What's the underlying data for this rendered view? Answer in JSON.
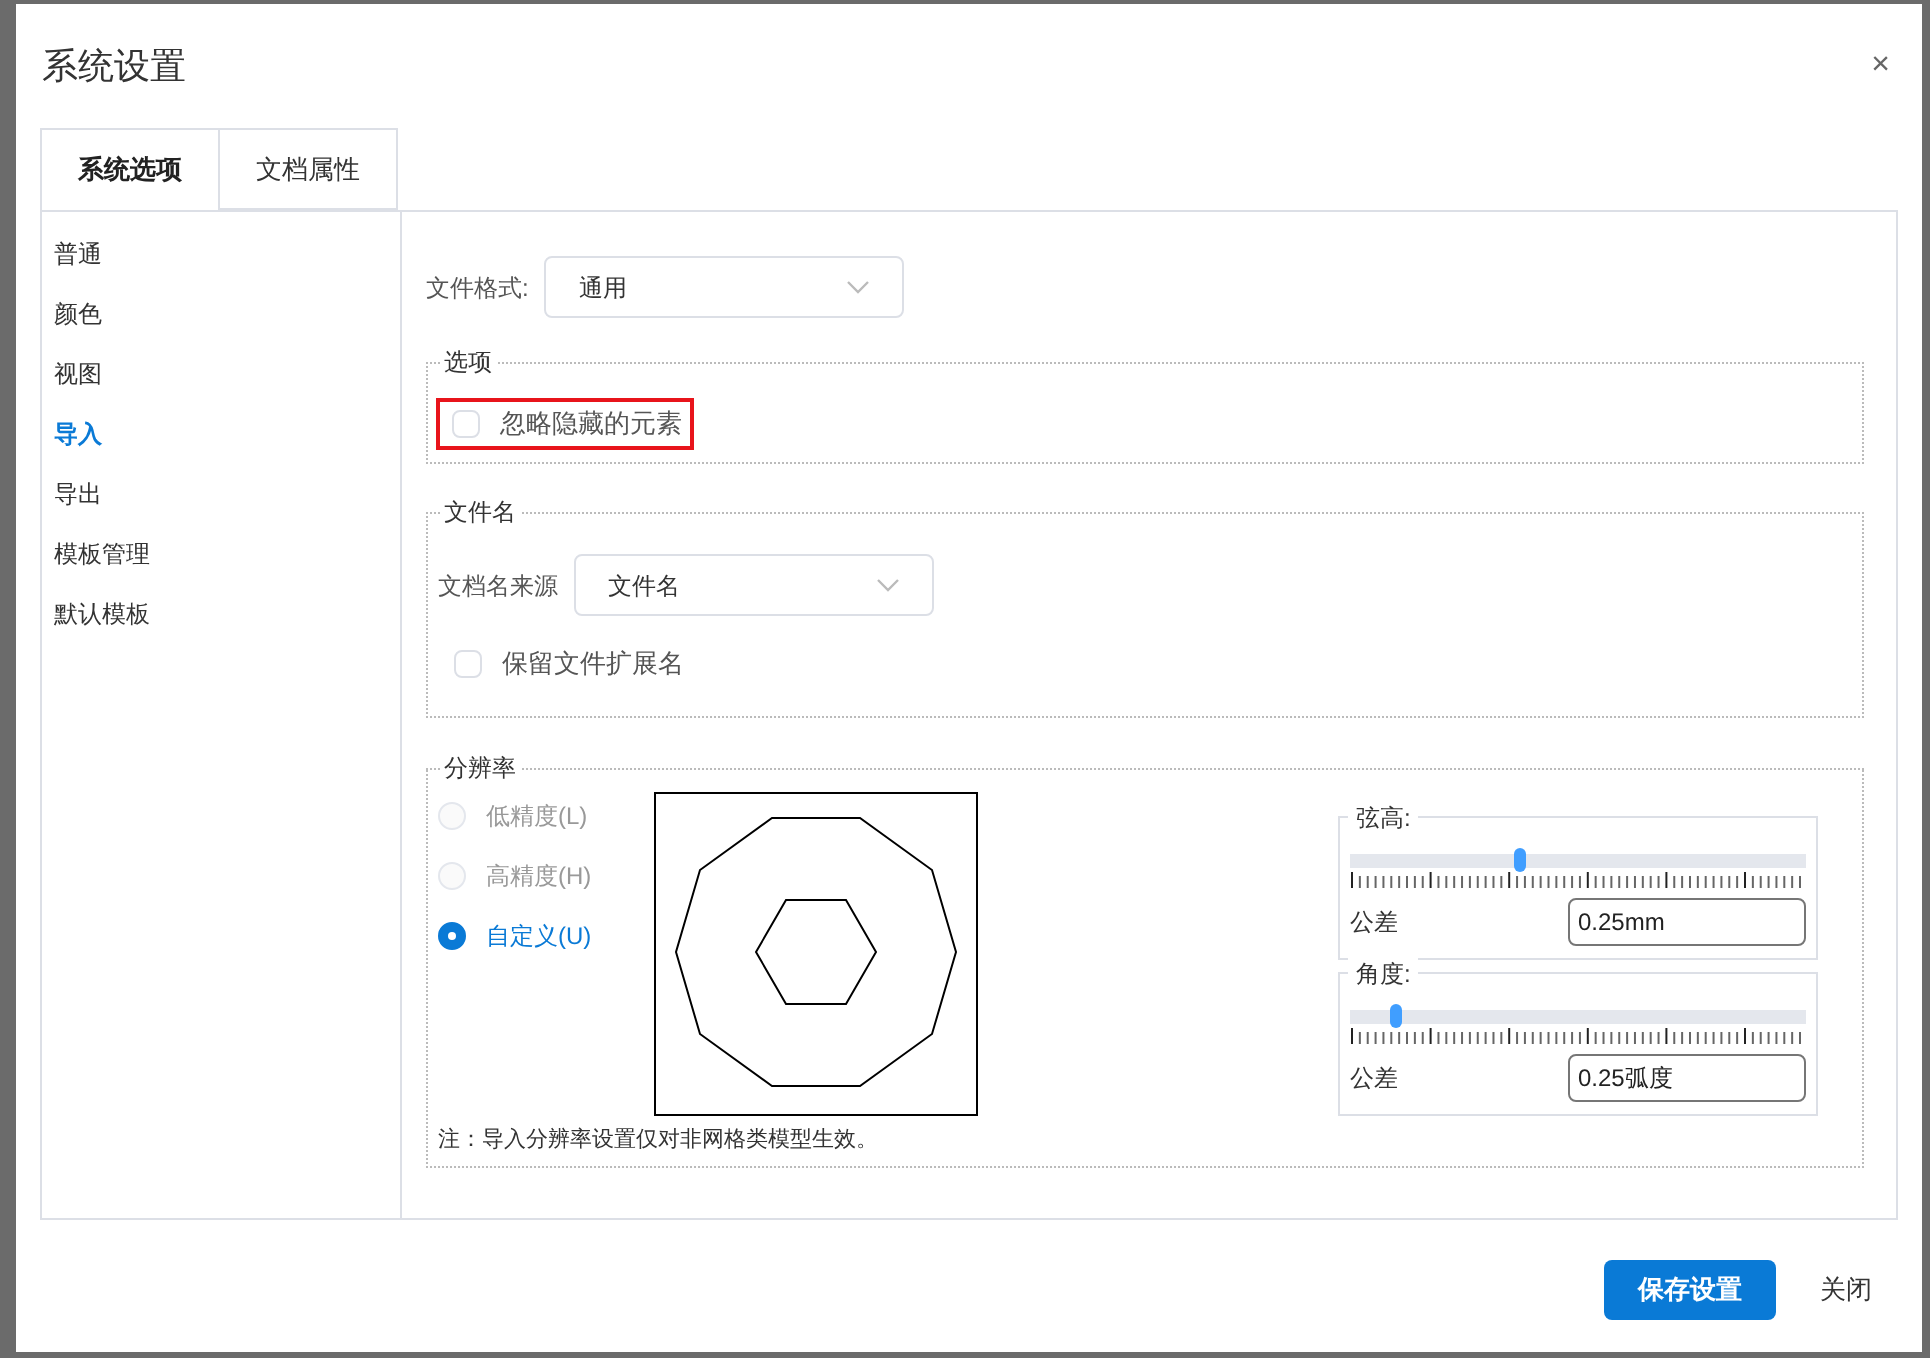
{
  "dialog": {
    "title": "系统设置",
    "close": "×"
  },
  "tabs": [
    {
      "label": "系统选项",
      "selected": true
    },
    {
      "label": "文档属性",
      "selected": false
    }
  ],
  "sidebar": {
    "items": [
      {
        "label": "普通",
        "selected": false
      },
      {
        "label": "颜色",
        "selected": false
      },
      {
        "label": "视图",
        "selected": false
      },
      {
        "label": "导入",
        "selected": true
      },
      {
        "label": "导出",
        "selected": false
      },
      {
        "label": "模板管理",
        "selected": false
      },
      {
        "label": "默认模板",
        "selected": false
      }
    ]
  },
  "file_format": {
    "label": "文件格式:",
    "value": "通用"
  },
  "options": {
    "legend": "选项",
    "items": [
      {
        "label": "忽略隐藏的元素",
        "checked": false,
        "highlighted": true
      }
    ]
  },
  "file_name": {
    "legend": "文件名",
    "source_label": "文档名来源",
    "source_value": "文件名",
    "keep_extension": {
      "label": "保留文件扩展名",
      "checked": false
    }
  },
  "resolution": {
    "legend": "分辨率",
    "radios": [
      {
        "label": "低精度(L)",
        "selected": false,
        "disabled": true
      },
      {
        "label": "高精度(H)",
        "selected": false,
        "disabled": true
      },
      {
        "label": "自定义(U)",
        "selected": true,
        "disabled": false
      }
    ],
    "sliders": [
      {
        "legend": "弦高:",
        "level": 0.37,
        "tolerance_label": "公差",
        "value": "0.25mm"
      },
      {
        "legend": "角度:",
        "level": 0.09,
        "tolerance_label": "公差",
        "value": "0.25弧度"
      }
    ],
    "note": "注：导入分辨率设置仅对非网格类模型生效。"
  },
  "buttons": {
    "save": "保存设置",
    "close": "关闭"
  }
}
